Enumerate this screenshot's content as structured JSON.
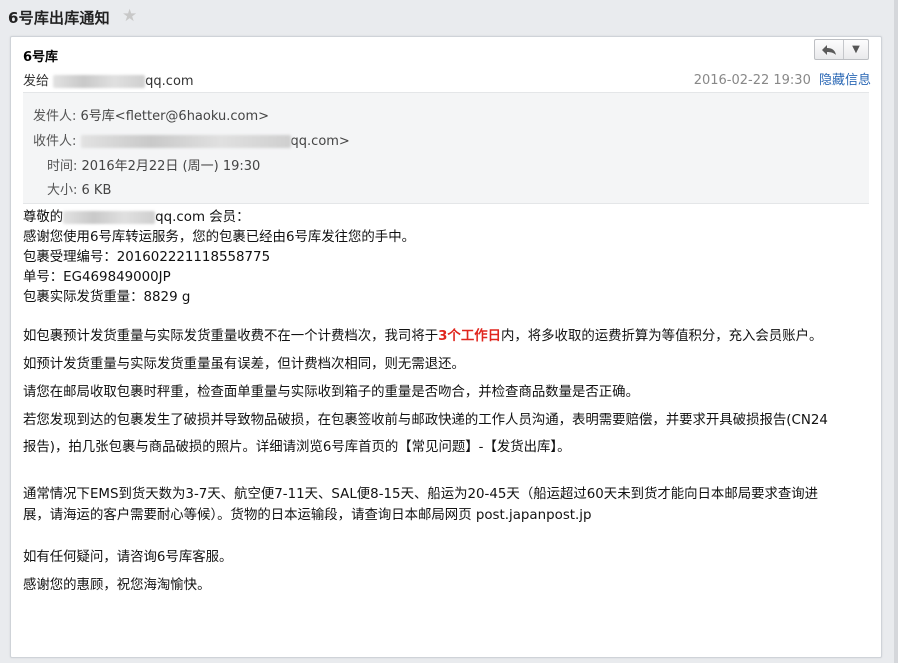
{
  "subject": "6号库出库通知",
  "star_icon": "star-icon",
  "sender_name": "6号库",
  "recipient_prefix": "发给",
  "recipient_suffix": "qq.com",
  "date": "2016-02-22 19:30",
  "hide_info": "隐藏信息",
  "toolbar": {
    "reply_icon": "reply-icon",
    "more_icon": "chevron-down-icon"
  },
  "details": {
    "from_label": "发件人:",
    "from_value": "6号库<fletter@6haoku.com>",
    "to_label": "收件人:",
    "to_value": "qq.com>",
    "time_label": "时间:",
    "time_value": "2016年2月22日 (周一) 19:30",
    "size_label": "大小:",
    "size_value": "6 KB"
  },
  "body": {
    "greeting_prefix": "尊敬的",
    "greeting_suffix": "qq.com 会员：",
    "line1": "感谢您使用6号库转运服务，您的包裹已经由6号库发往您的手中。",
    "line2": "包裹受理编号：201602221118558775",
    "line3": "单号：EG469849000JP",
    "line4": "包裹实际发货重量：8829 g",
    "para1_a": "如包裹预计发货重量与实际发货重量收费不在一个计费档次，我司将于",
    "para1_red": "3个工作日",
    "para1_b": "内，将多收取的运费折算为等值积分，充入会员账户。",
    "para2": "如预计发货重量与实际发货重量虽有误差，但计费档次相同，则无需退还。",
    "para3": "请您在邮局收取包裹时秤重，检查面单重量与实际收到箱子的重量是否吻合，并检查商品数量是否正确。",
    "para4_1": "若您发现到达的包裹发生了破损并导致物品破损，在包裹签收前与邮政快递的工作人员沟通，表明需要赔偿，并要求开具破损报告(CN24",
    "para4_2": "报告)，拍几张包裹与商品破损的照片。详细请浏览6号库首页的【常见问题】-【发货出库】。",
    "para5_1": "通常情况下EMS到货天数为3-7天、航空便7-11天、SAL便8-15天、船运为20-45天（船运超过60天未到货才能向日本邮局要求查询进",
    "para5_2": "展，请海运的客户需要耐心等候）。货物的日本运输段，请查询日本邮局网页 post.japanpost.jp",
    "para6": "如有任何疑问，请咨询6号库客服。",
    "para7": "感谢您的惠顾，祝您海淘愉快。"
  }
}
